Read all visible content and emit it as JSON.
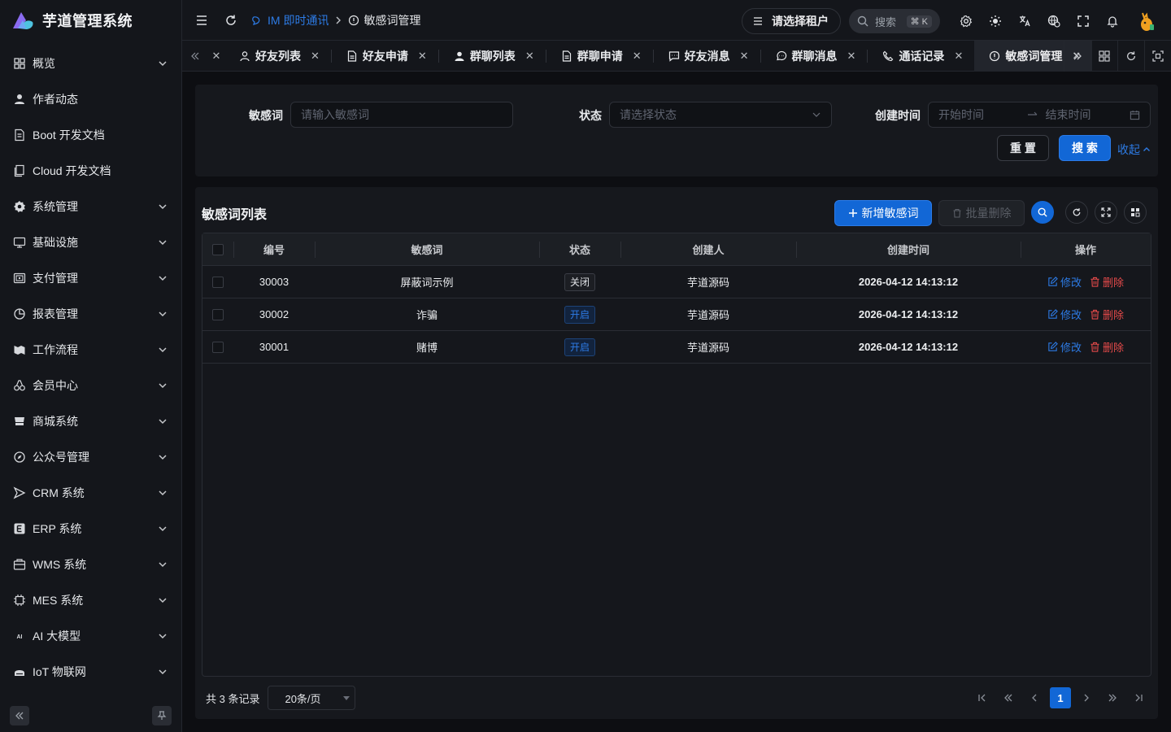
{
  "app": {
    "title": "芋道管理系统"
  },
  "sidebar": {
    "items": [
      {
        "label": "概览",
        "icon": "dashboard-icon",
        "expandable": true
      },
      {
        "label": "作者动态",
        "icon": "user-icon",
        "expandable": false
      },
      {
        "label": "Boot 开发文档",
        "icon": "document-icon",
        "expandable": false
      },
      {
        "label": "Cloud 开发文档",
        "icon": "document-copy-icon",
        "expandable": false
      },
      {
        "label": "系统管理",
        "icon": "gear-icon",
        "expandable": true
      },
      {
        "label": "基础设施",
        "icon": "monitor-icon",
        "expandable": true
      },
      {
        "label": "支付管理",
        "icon": "payment-icon",
        "expandable": true
      },
      {
        "label": "报表管理",
        "icon": "pie-chart-icon",
        "expandable": true
      },
      {
        "label": "工作流程",
        "icon": "workflow-icon",
        "expandable": true
      },
      {
        "label": "会员中心",
        "icon": "members-icon",
        "expandable": true
      },
      {
        "label": "商城系统",
        "icon": "shop-icon",
        "expandable": true
      },
      {
        "label": "公众号管理",
        "icon": "compass-icon",
        "expandable": true
      },
      {
        "label": "CRM 系统",
        "icon": "crm-icon",
        "expandable": true
      },
      {
        "label": "ERP 系统",
        "icon": "erp-icon",
        "expandable": true
      },
      {
        "label": "WMS 系统",
        "icon": "warehouse-icon",
        "expandable": true
      },
      {
        "label": "MES 系统",
        "icon": "chip-icon",
        "expandable": true
      },
      {
        "label": "AI 大模型",
        "icon": "ai-icon",
        "expandable": true
      },
      {
        "label": "IoT 物联网",
        "icon": "iot-icon",
        "expandable": true
      }
    ]
  },
  "header": {
    "breadcrumb": [
      "IM 即时通讯",
      "敏感词管理"
    ],
    "tenant_label": "请选择租户",
    "search_label": "搜索",
    "search_shortcut": "⌘ K"
  },
  "tabs": [
    {
      "label": "好友列表",
      "icon": "user-outline-icon",
      "active": false
    },
    {
      "label": "好友申请",
      "icon": "file-icon",
      "active": false
    },
    {
      "label": "群聊列表",
      "icon": "user-solid-icon",
      "active": false
    },
    {
      "label": "群聊申请",
      "icon": "file-icon",
      "active": false
    },
    {
      "label": "好友消息",
      "icon": "message-square-icon",
      "active": false
    },
    {
      "label": "群聊消息",
      "icon": "message-circle-icon",
      "active": false
    },
    {
      "label": "通话记录",
      "icon": "phone-icon",
      "active": false
    },
    {
      "label": "敏感词管理",
      "icon": "alert-circle-icon",
      "active": true
    }
  ],
  "filter": {
    "word_label": "敏感词",
    "word_placeholder": "请输入敏感词",
    "status_label": "状态",
    "status_placeholder": "请选择状态",
    "time_label": "创建时间",
    "start_placeholder": "开始时间",
    "end_placeholder": "结束时间",
    "reset_label": "重 置",
    "search_label": "搜 索",
    "collapse_label": "收起"
  },
  "list": {
    "title": "敏感词列表",
    "add_label": "新增敏感词",
    "batch_delete_label": "批量删除",
    "columns": [
      "编号",
      "敏感词",
      "状态",
      "创建人",
      "创建时间",
      "操作"
    ],
    "edit_label": "修改",
    "delete_label": "删除",
    "rows": [
      {
        "id": "30003",
        "word": "屏蔽词示例",
        "status": "关闭",
        "status_on": false,
        "creator": "芋道源码",
        "created": "2026-04-12 14:13:12"
      },
      {
        "id": "30002",
        "word": "诈骗",
        "status": "开启",
        "status_on": true,
        "creator": "芋道源码",
        "created": "2026-04-12 14:13:12"
      },
      {
        "id": "30001",
        "word": "赌博",
        "status": "开启",
        "status_on": true,
        "creator": "芋道源码",
        "created": "2026-04-12 14:13:12"
      }
    ]
  },
  "pagination": {
    "total_text": "共 3 条记录",
    "page_size": "20条/页",
    "current_page": "1"
  },
  "colors": {
    "primary": "#1267d6",
    "link": "#2d7be5",
    "danger": "#e54a4a",
    "background": "#0d0e12"
  }
}
